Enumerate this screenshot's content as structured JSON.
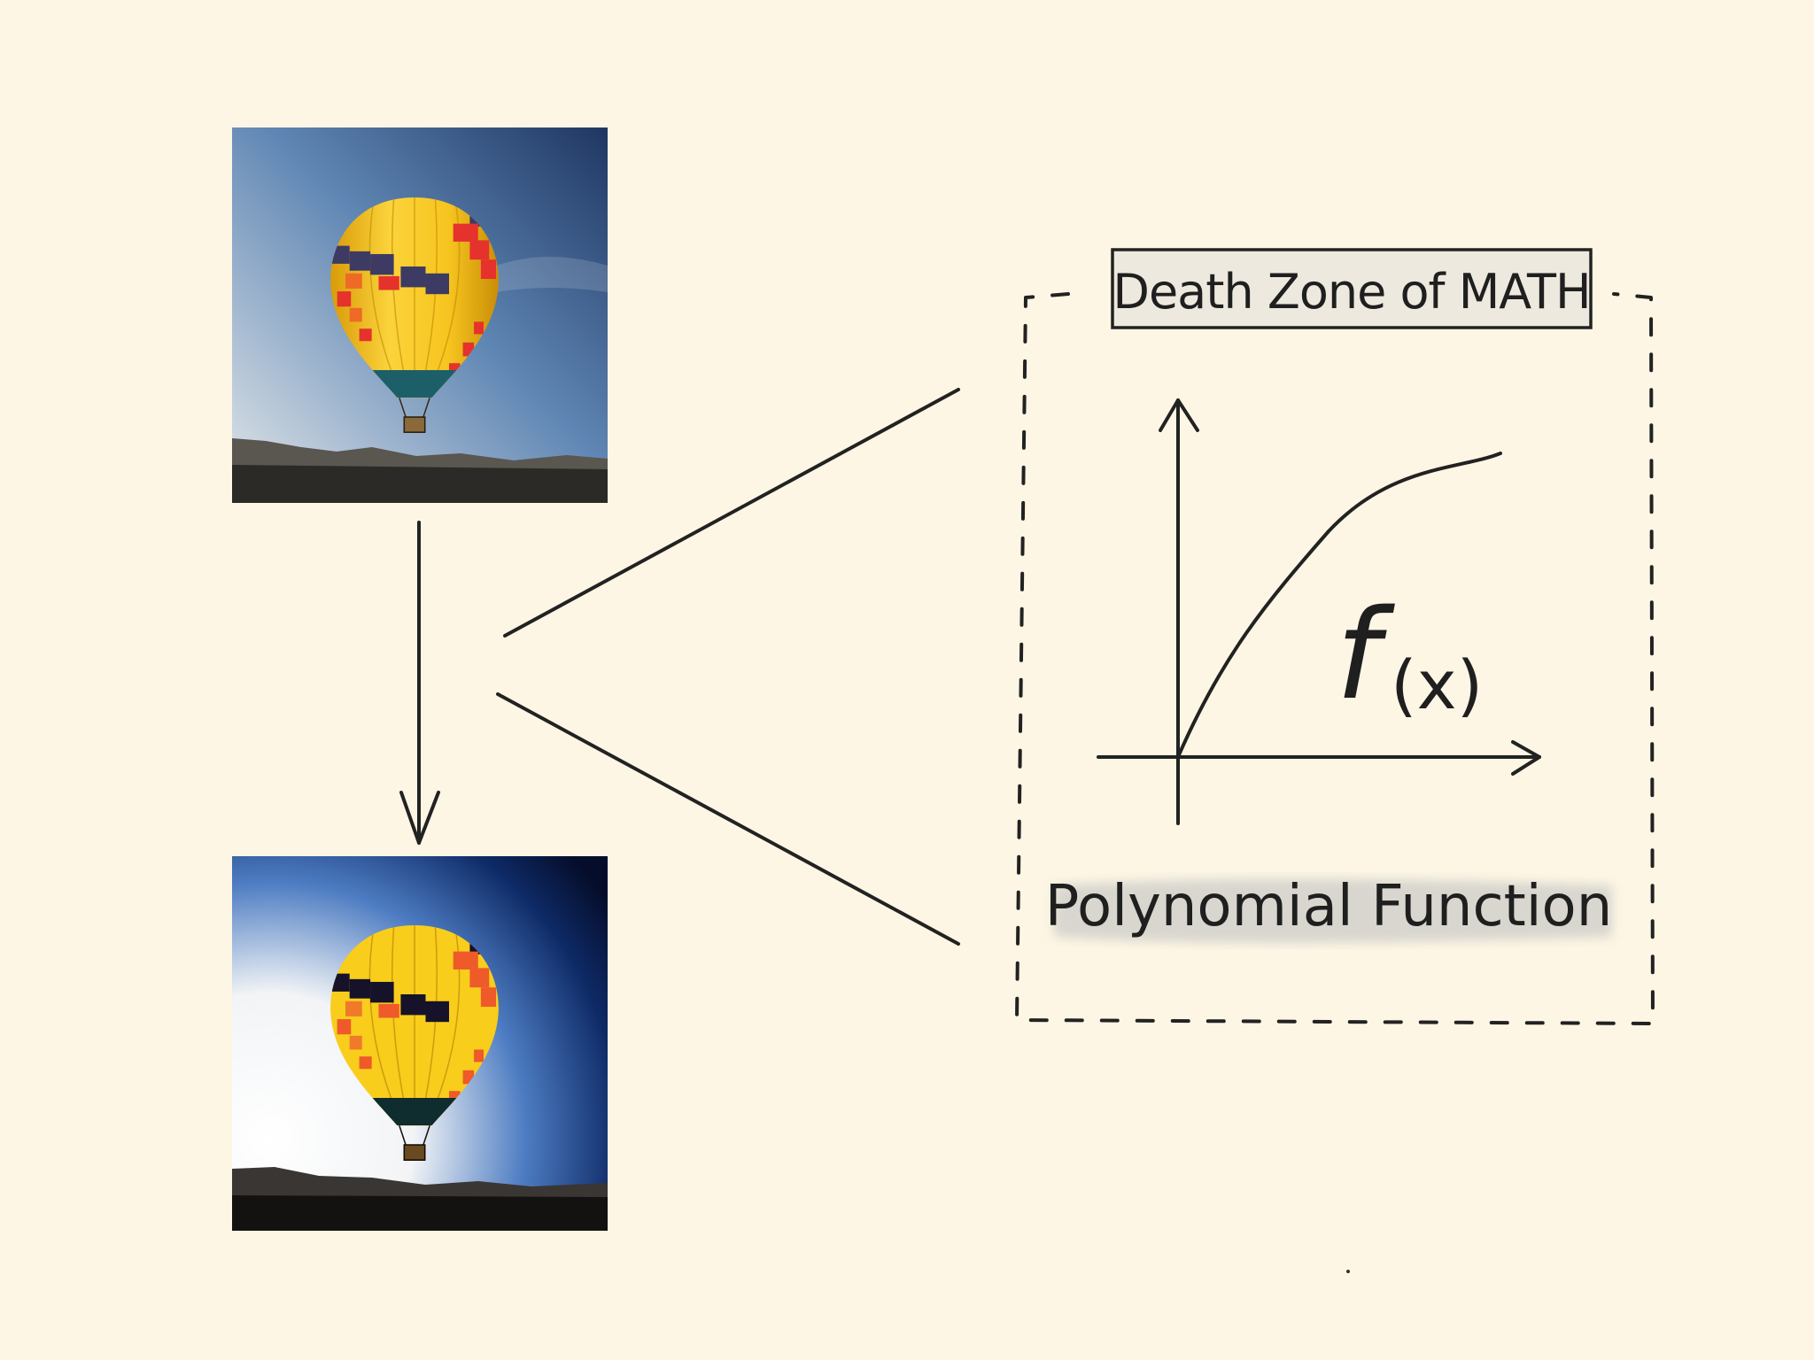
{
  "diagram": {
    "title": "Death Zone of MATH",
    "caption": "Polynomial Function",
    "function_label": "f(x)",
    "function_main": "f",
    "function_arg": "(x)",
    "images": {
      "top": "hot-air-balloon-original",
      "bottom": "hot-air-balloon-enhanced"
    },
    "colors": {
      "background": "#fdf6e4",
      "ink": "#222222",
      "title_box": "#ede9df",
      "balloon_yellow": "#f5c518",
      "balloon_red": "#e83a2a",
      "balloon_navy": "#3a3760",
      "sky_top": "#2f4a7a",
      "sky_bottom": "#cfdbe6"
    }
  }
}
